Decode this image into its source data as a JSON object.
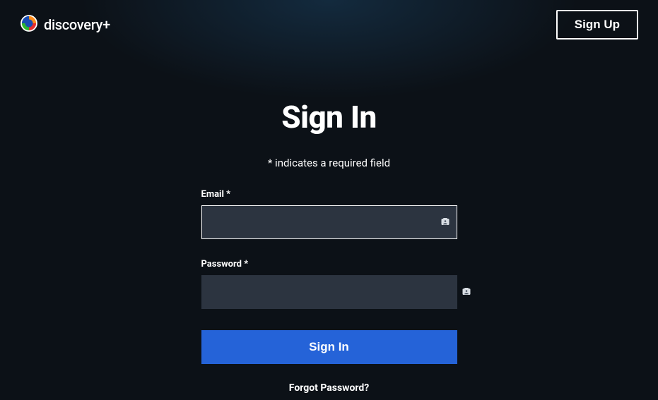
{
  "header": {
    "logo_text": "discovery+",
    "signup_label": "Sign Up"
  },
  "main": {
    "title": "Sign In",
    "required_note": "* indicates a required field",
    "email_label": "Email *",
    "password_label": "Password *",
    "signin_label": "Sign In",
    "forgot_label": "Forgot Password?"
  }
}
